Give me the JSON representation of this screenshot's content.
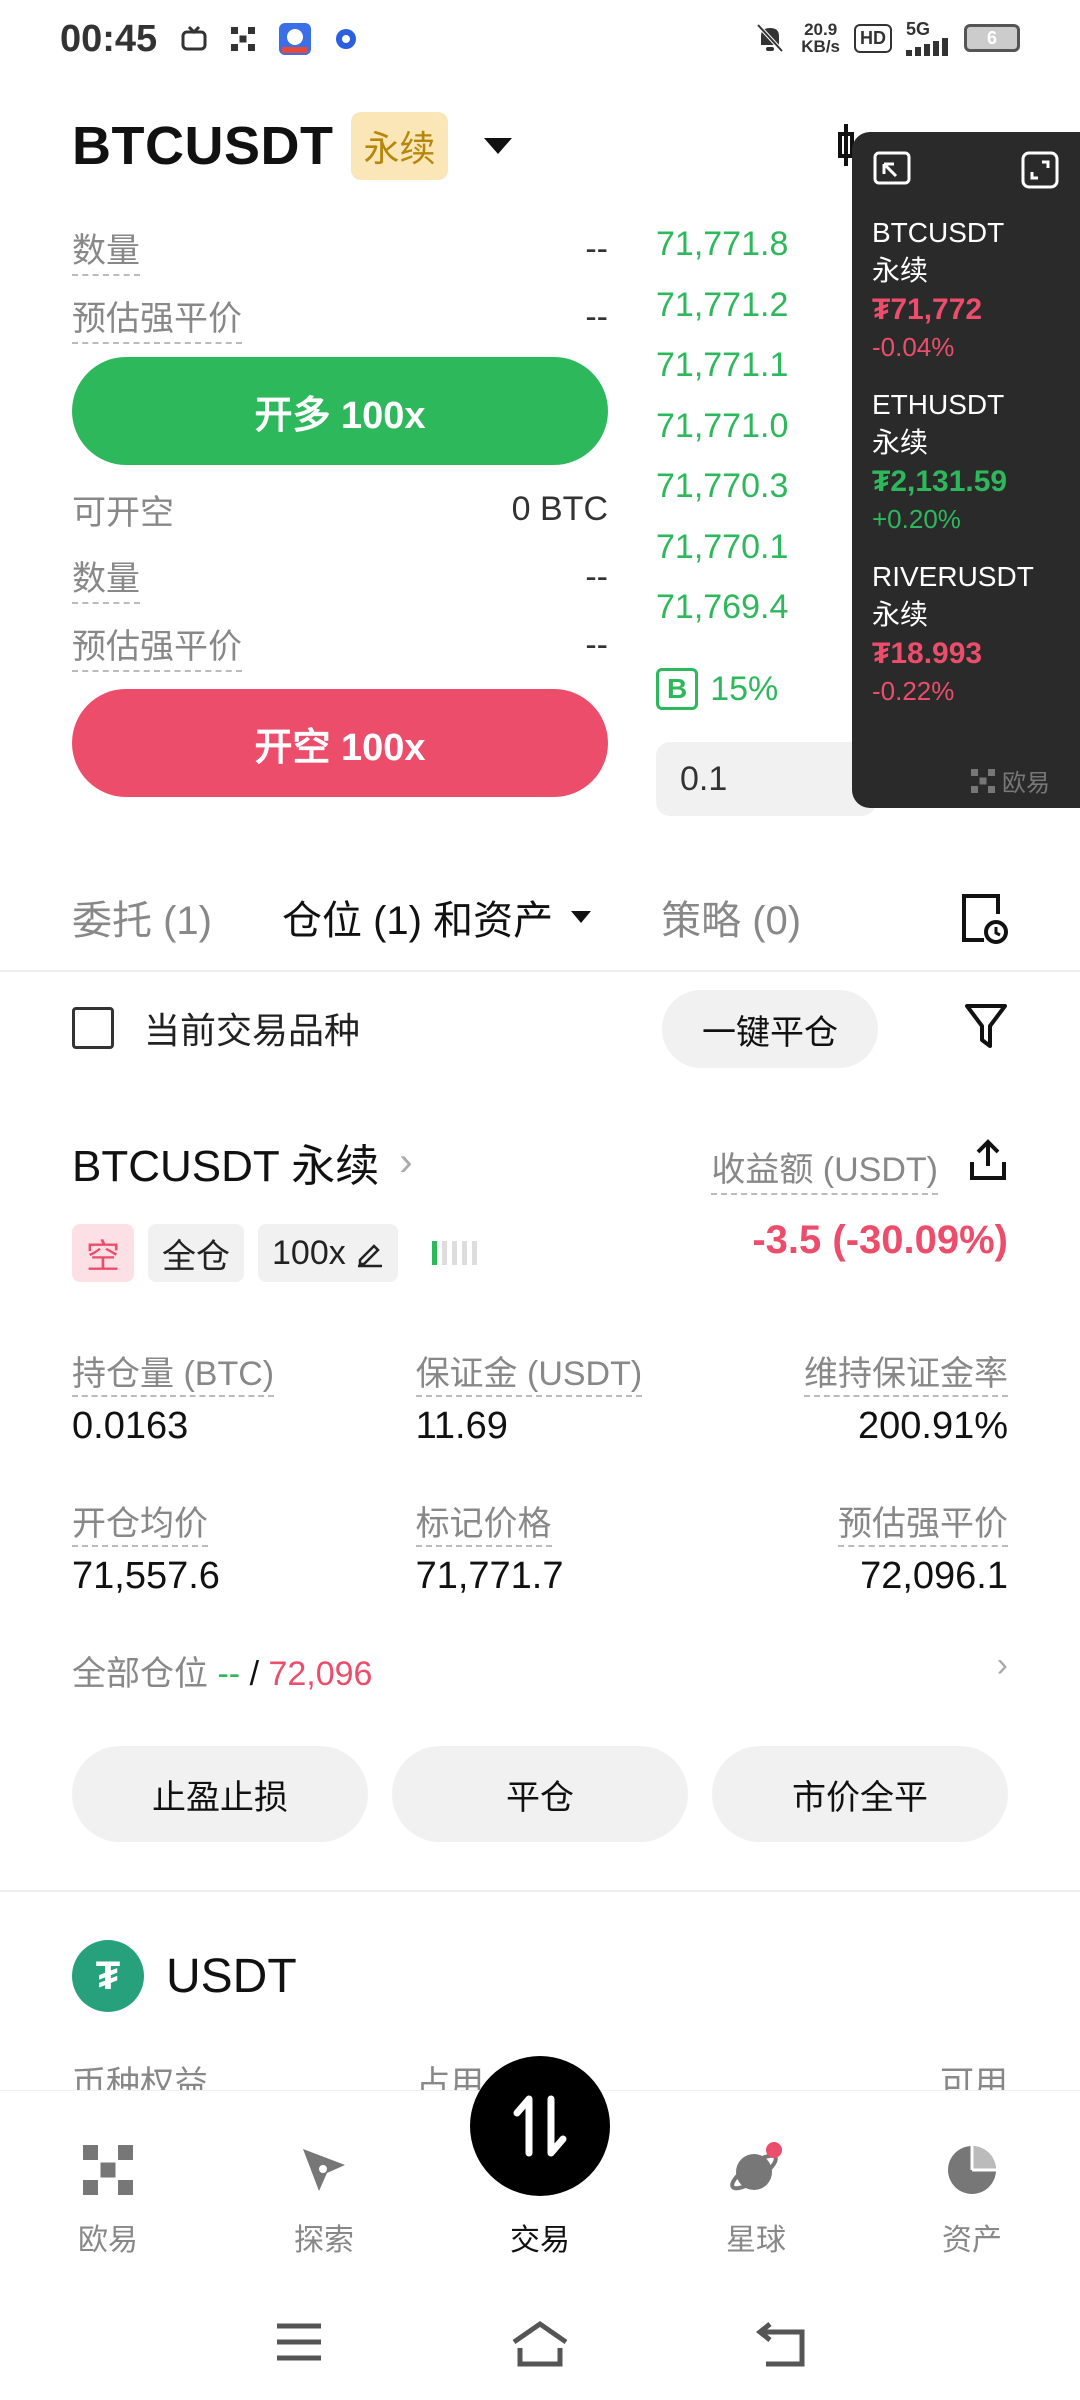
{
  "status_bar": {
    "time": "00:45",
    "net_speed_value": "20.9",
    "net_speed_unit": "KB/s",
    "hd": "HD",
    "signal": "5G",
    "battery": "6"
  },
  "header": {
    "pair": "BTCUSDT",
    "contract_type": "永续"
  },
  "long_form": {
    "qty_label": "数量",
    "qty_value": "--",
    "liq_label": "预估强平价",
    "liq_value": "--",
    "button_label": "开多 100x"
  },
  "short_form": {
    "available_label": "可开空",
    "available_value": "0 BTC",
    "qty_label": "数量",
    "qty_value": "--",
    "liq_label": "预估强平价",
    "liq_value": "--",
    "button_label": "开空 100x"
  },
  "orderbook": {
    "prices": [
      "71,771.8",
      "71,771.2",
      "71,771.1",
      "71,771.0",
      "71,770.3",
      "71,770.1",
      "71,769.4"
    ],
    "buy_badge": "B",
    "buy_ratio": "15%",
    "quantity_input": "0.1"
  },
  "watchlist": {
    "items": [
      {
        "name": "BTCUSDT",
        "type": "永续",
        "price": "₮71,772",
        "change": "-0.04%",
        "dir": "down"
      },
      {
        "name": "ETHUSDT",
        "type": "永续",
        "price": "₮2,131.59",
        "change": "+0.20%",
        "dir": "up"
      },
      {
        "name": "RIVERUSDT",
        "type": "永续",
        "price": "₮18.993",
        "change": "-0.22%",
        "dir": "down"
      }
    ],
    "brand": "欧易"
  },
  "tabs": {
    "orders": "委托 (1)",
    "positions": "仓位 (1) 和资产",
    "strategies": "策略 (0)"
  },
  "filter": {
    "current_instrument": "当前交易品种",
    "close_all": "一键平仓"
  },
  "position": {
    "title": "BTCUSDT 永续",
    "pnl_label": "收益额 (USDT)",
    "side_tag": "空",
    "margin_mode": "全仓",
    "leverage": "100x",
    "pnl_value": "-3.5 (-30.09%)",
    "stats": [
      [
        {
          "label": "持仓量 (BTC)",
          "value": "0.0163"
        },
        {
          "label": "保证金 (USDT)",
          "value": "11.69"
        },
        {
          "label": "维持保证金率",
          "value": "200.91%"
        }
      ],
      [
        {
          "label": "开仓均价",
          "value": "71,557.6"
        },
        {
          "label": "标记价格",
          "value": "71,771.7"
        },
        {
          "label": "预估强平价",
          "value": "72,096.1"
        }
      ]
    ],
    "all_positions_label": "全部仓位",
    "all_positions_tp": "--",
    "all_positions_sep": "/",
    "all_positions_sl": "72,096",
    "actions": [
      "止盈止损",
      "平仓",
      "市价全平"
    ]
  },
  "asset": {
    "name": "USDT",
    "logo": "₮",
    "col1": "币种权益",
    "col2": "占用",
    "col3": "可用"
  },
  "bottom_nav": {
    "items": [
      "欧易",
      "探索",
      "交易",
      "星球",
      "资产"
    ]
  },
  "colors": {
    "green": "#2eb85c",
    "red": "#ec4d6b",
    "perp_badge_bg": "#fbe6b8",
    "usdt": "#26a17b"
  }
}
